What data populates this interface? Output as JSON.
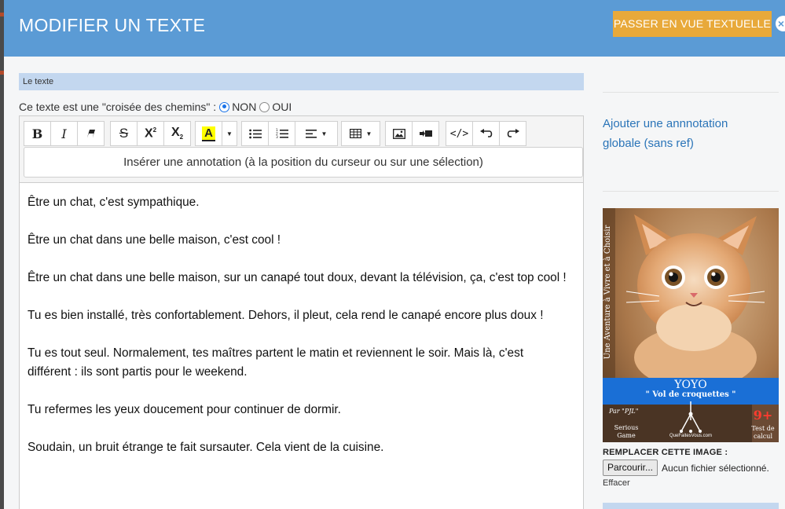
{
  "modal": {
    "title": "MODIFIER UN TEXTE",
    "text_view_button": "PASSER EN VUE TEXTUELLE",
    "close_label": "×"
  },
  "section": {
    "label": "Le texte"
  },
  "crossroad": {
    "question": "Ce texte est une \"croisée des chemins\" :",
    "options": [
      "NON",
      "OUI"
    ],
    "selected": "NON"
  },
  "toolbar": {
    "icons": [
      "bold-icon",
      "italic-icon",
      "clear-format-icon",
      "strikethrough-icon",
      "superscript-icon",
      "subscript-icon",
      "highlight-color-icon",
      "bullet-list-icon",
      "numbered-list-icon",
      "align-icon",
      "table-icon",
      "image-icon",
      "video-icon",
      "code-view-icon",
      "undo-icon",
      "redo-icon"
    ],
    "highlight_color": "#ffff00",
    "annotation_button": "Insérer une annotation (à la position du curseur ou sur une sélection)"
  },
  "content": {
    "paragraphs": [
      "Être un chat, c'est sympathique.",
      "Être un chat dans une belle maison, c'est cool !",
      "Être un chat dans une belle maison, sur un canapé tout doux, devant la télévision, ça, c'est top cool !",
      "Tu es bien installé, très confortablement. Dehors, il pleut, cela rend le canapé encore plus doux !",
      "Tu es tout seul. Normalement, tes maîtres partent le matin et reviennent le soir. Mais là, c'est différent : ils sont partis pour le weekend.",
      "Tu refermes les yeux doucement pour continuer de dormir.",
      "Soudain, un bruit étrange te fait sursauter. Cela vient de la cuisine."
    ]
  },
  "sidebar": {
    "global_annotation_link": "Ajouter une annnotation globale (sans ref)",
    "cover": {
      "vertical_text": "Une Aventure à Vivre et à Choisir",
      "title": "YOYO",
      "subtitle": "\" Vol de croquettes \"",
      "author": "Par \"PJL\"",
      "genre": "Serious Game",
      "site": "QueFaitesVous.com",
      "age": "9+",
      "category": "Test de calcul"
    },
    "replace_image_label": "REMPLACER CETTE IMAGE :",
    "browse_button": "Parcourir...",
    "file_status": "Aucun fichier sélectionné.",
    "clear_link": "Effacer"
  },
  "colors": {
    "header": "#5b9bd5",
    "text_view_button": "#e8a93a",
    "section_bg": "#c3d7ef",
    "link": "#2a74b8",
    "radio_checked": "#1a73e8"
  }
}
